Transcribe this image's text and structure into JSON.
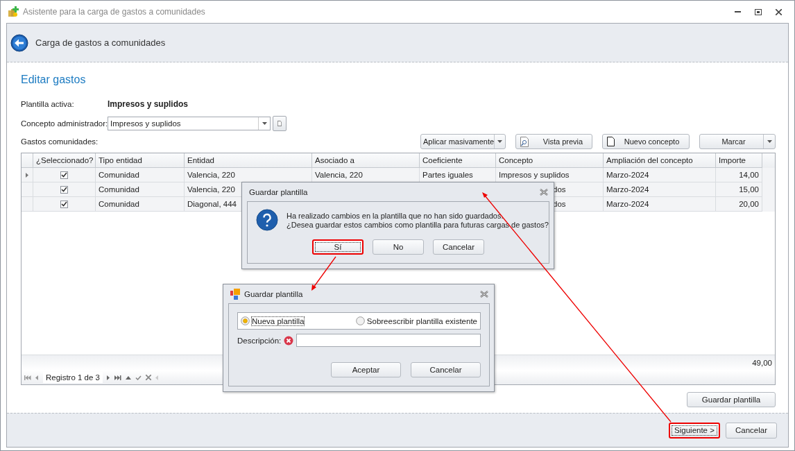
{
  "window": {
    "title": "Asistente para la carga de gastos a comunidades"
  },
  "header": {
    "title": "Carga de gastos a comunidades"
  },
  "section_title": "Editar gastos",
  "active_template": {
    "label": "Plantilla activa:",
    "value": "Impresos y suplidos"
  },
  "admin_concept": {
    "label": "Concepto administrador:",
    "value": "Impresos y suplidos"
  },
  "grid_label": "Gastos comunidades:",
  "toolbar": [
    {
      "label": "Aplicar masivamente",
      "kind": "split"
    },
    {
      "label": "Vista previa",
      "kind": "preview"
    },
    {
      "label": "Nuevo concepto",
      "kind": "new"
    },
    {
      "label": "Marcar",
      "kind": "split"
    }
  ],
  "table": {
    "columns": [
      "¿Seleccionado?",
      "Tipo entidad",
      "Entidad",
      "Asociado a",
      "Coeficiente",
      "Concepto",
      "Ampliación del concepto",
      "Importe"
    ],
    "rows": [
      {
        "current": true,
        "checked": true,
        "cells": [
          "",
          "Comunidad",
          "Valencia, 220",
          "Valencia, 220",
          "Partes iguales",
          "Impresos y suplidos",
          "Marzo-2024",
          "14,00"
        ]
      },
      {
        "current": false,
        "checked": true,
        "cells": [
          "",
          "Comunidad",
          "Valencia, 220",
          null,
          null,
          "dos",
          "Marzo-2024",
          "15,00"
        ]
      },
      {
        "current": false,
        "checked": true,
        "cells": [
          "",
          "Comunidad",
          "Diagonal, 444",
          null,
          null,
          "dos",
          "Marzo-2024",
          "20,00"
        ]
      }
    ],
    "total": "49,00",
    "navigator": "Registro 1 de 3"
  },
  "save_template_button": "Guardar plantilla",
  "footer_buttons": [
    {
      "label": "Siguiente >",
      "highlighted": true
    },
    {
      "label": "Cancelar",
      "highlighted": false
    }
  ],
  "confirm_dialog": {
    "title": "Guardar plantilla",
    "lines": [
      "Ha realizado cambios en la plantilla que no han sido guardados.",
      "¿Desea guardar estos cambios como plantilla para futuras cargas de gastos?"
    ],
    "buttons": [
      {
        "label": "Sí",
        "highlighted": true
      },
      {
        "label": "No",
        "highlighted": false
      },
      {
        "label": "Cancelar",
        "highlighted": false
      }
    ]
  },
  "save_dialog": {
    "title": "Guardar plantilla",
    "options": [
      {
        "label": "Nueva plantilla",
        "selected": true
      },
      {
        "label": "Sobreescribir plantilla existente",
        "selected": false
      }
    ],
    "description_label": "Descripción:",
    "description_error": true,
    "buttons": [
      {
        "label": "Aceptar"
      },
      {
        "label": "Cancelar"
      }
    ]
  }
}
